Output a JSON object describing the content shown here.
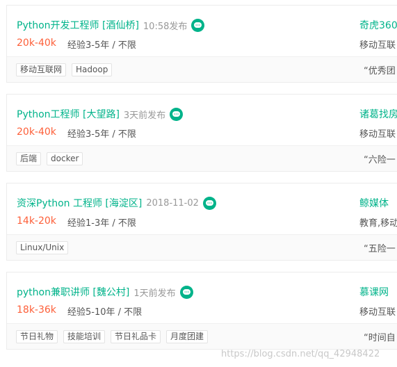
{
  "jobs": [
    {
      "title": "Python开发工程师 [酒仙桥]",
      "time": "10:58发布",
      "salary": "20k-40k",
      "requirement": "经验3-5年 / 不限",
      "company": "奇虎360",
      "industry": "移动互联",
      "tags": [
        "移动互联网",
        "Hadoop"
      ],
      "advantage": "“优秀团"
    },
    {
      "title": "Python工程师 [大望路]",
      "time": "3天前发布",
      "salary": "20k-40k",
      "requirement": "经验3-5年 / 不限",
      "company": "诸葛找房",
      "industry": "移动互联",
      "tags": [
        "后端",
        "docker"
      ],
      "advantage": "“六险一"
    },
    {
      "title": "资深Python 工程师 [海淀区]",
      "time": "2018-11-02",
      "salary": "14k-20k",
      "requirement": "经验1-3年 / 不限",
      "company": "鲸媒体",
      "industry": "教育,移动",
      "tags": [
        "Linux/Unix"
      ],
      "advantage": "“五险一"
    },
    {
      "title": "python兼职讲师 [魏公村]",
      "time": "1天前发布",
      "salary": "18k-36k",
      "requirement": "经验5-10年 / 不限",
      "company": "慕课网",
      "industry": "移动互联",
      "tags": [
        "节日礼物",
        "技能培训",
        "节日礼品卡",
        "月度团建"
      ],
      "advantage": "“时间自"
    }
  ],
  "watermark": "https://blog.csdn.net/qq_42948422",
  "colors": {
    "accent": "#00b38a",
    "salary": "#fd5f39"
  }
}
